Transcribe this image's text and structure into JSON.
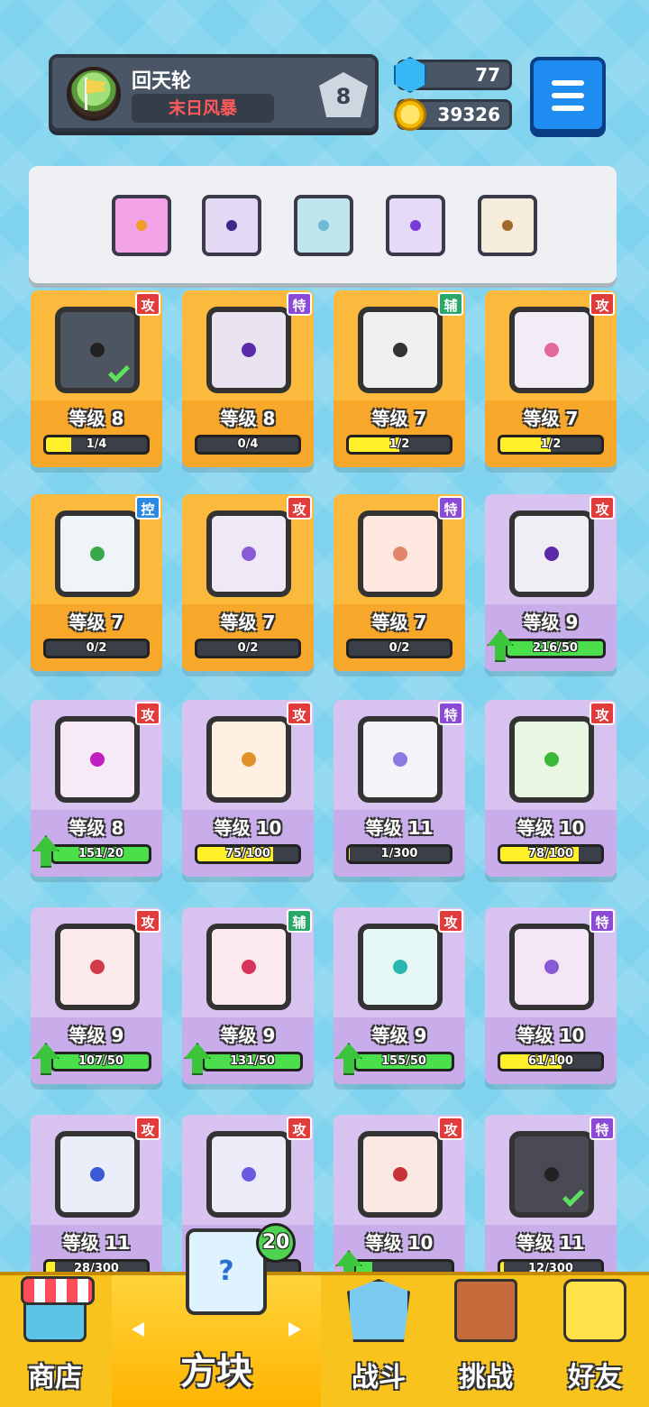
{
  "player": {
    "name": "回天轮",
    "title": "末日风暴",
    "rank": "8"
  },
  "currency": {
    "gems": "77",
    "coins": "39326",
    "gem_icon": "gem-icon",
    "coin_icon": "coin-icon"
  },
  "deck": [
    {
      "icon": "sun-dice-icon",
      "color": "#f2a3e8",
      "dot": "#f29a2a"
    },
    {
      "icon": "crack-dice-icon",
      "color": "#e3d9f5",
      "dot": "#3a2a8a"
    },
    {
      "icon": "vortex-dice-icon",
      "color": "#bfe6ef",
      "dot": "#6fb8d6"
    },
    {
      "icon": "energy-dice-icon",
      "color": "#e6dbf7",
      "dot": "#7a3ad6"
    },
    {
      "icon": "mystery-dice-icon",
      "color": "#f5ecdc",
      "dot": "#a06a2a"
    }
  ],
  "cards": [
    {
      "tag": "攻",
      "tag_color": "#e23b3b",
      "level": "等级 8",
      "progress": "1/4",
      "fill": 0.25,
      "bar": "yellow",
      "state": "owned",
      "art": "#4d5560",
      "dot": "#222",
      "check": true,
      "upgrade": false
    },
    {
      "tag": "特",
      "tag_color": "#8a4ad6",
      "level": "等级 8",
      "progress": "0/4",
      "fill": 0,
      "bar": "yellow",
      "state": "owned",
      "art": "#e9e4f0",
      "dot": "#5b2aa8",
      "check": false,
      "upgrade": false
    },
    {
      "tag": "辅",
      "tag_color": "#2aa86a",
      "level": "等级 7",
      "progress": "1/2",
      "fill": 0.5,
      "bar": "yellow",
      "state": "owned",
      "art": "#f0f0f0",
      "dot": "#333",
      "check": false,
      "upgrade": false
    },
    {
      "tag": "攻",
      "tag_color": "#e23b3b",
      "level": "等级 7",
      "progress": "1/2",
      "fill": 0.5,
      "bar": "yellow",
      "state": "owned",
      "art": "#f2ecf7",
      "dot": "#e26a9a",
      "check": false,
      "upgrade": false
    },
    {
      "tag": "控",
      "tag_color": "#2a8ae2",
      "level": "等级 7",
      "progress": "0/2",
      "fill": 0,
      "bar": "yellow",
      "state": "owned",
      "art": "#eef4f8",
      "dot": "#3aa84a",
      "check": false,
      "upgrade": false
    },
    {
      "tag": "攻",
      "tag_color": "#e23b3b",
      "level": "等级 7",
      "progress": "0/2",
      "fill": 0,
      "bar": "yellow",
      "state": "owned",
      "art": "#efe8f6",
      "dot": "#8a5ad6",
      "check": false,
      "upgrade": false
    },
    {
      "tag": "特",
      "tag_color": "#8a4ad6",
      "level": "等级 7",
      "progress": "0/2",
      "fill": 0,
      "bar": "yellow",
      "state": "owned",
      "art": "#fde7df",
      "dot": "#e2846a",
      "check": false,
      "upgrade": false
    },
    {
      "tag": "攻",
      "tag_color": "#e23b3b",
      "level": "等级 9",
      "progress": "216/50",
      "fill": 1,
      "bar": "green",
      "state": "new",
      "art": "#f0eef5",
      "dot": "#5b2aa8",
      "check": false,
      "upgrade": true
    },
    {
      "tag": "攻",
      "tag_color": "#e23b3b",
      "level": "等级 8",
      "progress": "151/20",
      "fill": 1,
      "bar": "green",
      "state": "new",
      "art": "#f7eaf7",
      "dot": "#c01ec0",
      "check": false,
      "upgrade": true
    },
    {
      "tag": "攻",
      "tag_color": "#e23b3b",
      "level": "等级 10",
      "progress": "75/100",
      "fill": 0.75,
      "bar": "yellow",
      "state": "new",
      "art": "#fdf0e2",
      "dot": "#e2902a",
      "check": false,
      "upgrade": false
    },
    {
      "tag": "特",
      "tag_color": "#8a4ad6",
      "level": "等级 11",
      "progress": "1/300",
      "fill": 0.003,
      "bar": "yellow",
      "state": "new",
      "art": "#f4f4f8",
      "dot": "#8a7ae2",
      "check": false,
      "upgrade": false
    },
    {
      "tag": "攻",
      "tag_color": "#e23b3b",
      "level": "等级 10",
      "progress": "78/100",
      "fill": 0.78,
      "bar": "yellow",
      "state": "new",
      "art": "#e8f6e2",
      "dot": "#3ab83a",
      "check": false,
      "upgrade": false
    },
    {
      "tag": "攻",
      "tag_color": "#e23b3b",
      "level": "等级 9",
      "progress": "107/50",
      "fill": 1,
      "bar": "green",
      "state": "new",
      "art": "#fbeaea",
      "dot": "#d23a4a",
      "check": false,
      "upgrade": true
    },
    {
      "tag": "辅",
      "tag_color": "#2aa86a",
      "level": "等级 9",
      "progress": "131/50",
      "fill": 1,
      "bar": "green",
      "state": "new",
      "art": "#fbeaee",
      "dot": "#d8325a",
      "check": false,
      "upgrade": true
    },
    {
      "tag": "攻",
      "tag_color": "#e23b3b",
      "level": "等级 9",
      "progress": "155/50",
      "fill": 1,
      "bar": "green",
      "state": "new",
      "art": "#e6f8f6",
      "dot": "#2ab8b0",
      "check": false,
      "upgrade": true
    },
    {
      "tag": "特",
      "tag_color": "#8a4ad6",
      "level": "等级 10",
      "progress": "61/100",
      "fill": 0.61,
      "bar": "yellow",
      "state": "new",
      "art": "#f3e6f7",
      "dot": "#8a5ad6",
      "check": false,
      "upgrade": false
    },
    {
      "tag": "攻",
      "tag_color": "#e23b3b",
      "level": "等级 11",
      "progress": "28/300",
      "fill": 0.09,
      "bar": "yellow",
      "state": "new",
      "art": "#eaeef8",
      "dot": "#3a5ad6",
      "check": false,
      "upgrade": false
    },
    {
      "tag": "攻",
      "tag_color": "#e23b3b",
      "level": "",
      "progress": "",
      "fill": 0,
      "bar": "yellow",
      "state": "new",
      "art": "#ecebf8",
      "dot": "#6a5ae2",
      "check": false,
      "upgrade": false
    },
    {
      "tag": "攻",
      "tag_color": "#e23b3b",
      "level": "等级 10",
      "progress": "",
      "fill": 0.17,
      "bar": "green",
      "state": "new",
      "art": "#fbe8e2",
      "dot": "#c8323a",
      "check": false,
      "upgrade": true
    },
    {
      "tag": "特",
      "tag_color": "#8a4ad6",
      "level": "等级 11",
      "progress": "12/300",
      "fill": 0.04,
      "bar": "yellow",
      "state": "new",
      "art": "#4a4a55",
      "dot": "#222",
      "check": true,
      "upgrade": false
    }
  ],
  "nav": {
    "shop": "商店",
    "dice": "方块",
    "battle": "战斗",
    "challenge": "挑战",
    "friends": "好友",
    "dice_count": "20",
    "cube_mark": "?"
  }
}
